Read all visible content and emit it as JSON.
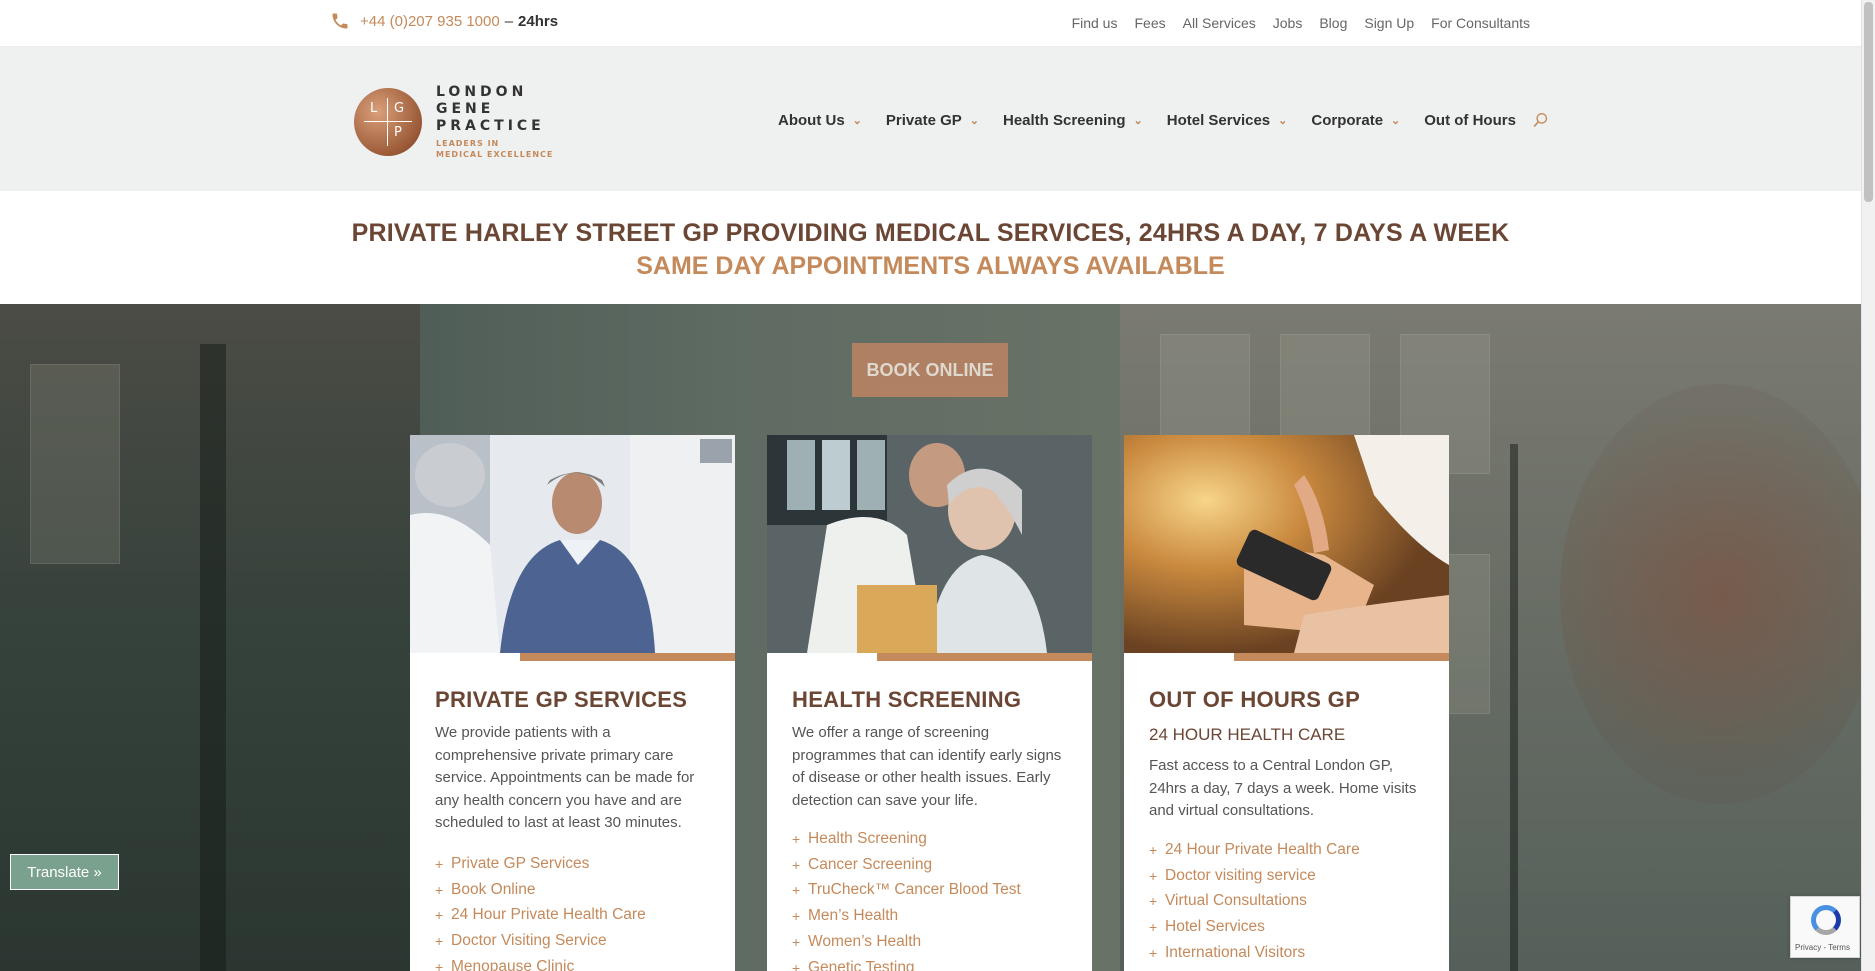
{
  "topbar": {
    "phone": "+44 (0)207 935 1000",
    "separator": "–",
    "hours": "24hrs",
    "links": [
      "Find us",
      "Fees",
      "All Services",
      "Jobs",
      "Blog",
      "Sign Up",
      "For Consultants"
    ]
  },
  "logo": {
    "letters": [
      "L",
      "G",
      "P"
    ],
    "name_lines": [
      "LONDON",
      "GENE",
      "PRACTICE"
    ],
    "tagline_lines": [
      "LEADERS IN",
      "MEDICAL EXCELLENCE"
    ]
  },
  "nav": {
    "items": [
      "About Us",
      "Private GP",
      "Health Screening",
      "Hotel Services",
      "Corporate",
      "Out of Hours"
    ]
  },
  "tagline": {
    "line1": "PRIVATE HARLEY STREET GP PROVIDING MEDICAL SERVICES, 24HRS A DAY, 7 DAYS A WEEK",
    "line2": "SAME DAY APPOINTMENTS ALWAYS AVAILABLE"
  },
  "hero": {
    "book_label": "BOOK ONLINE"
  },
  "cards": [
    {
      "title": "PRIVATE GP SERVICES",
      "subtitle": "",
      "description": "We provide patients with a comprehensive private primary care service. Appointments can be made for any health concern you have and are scheduled to last at least 30 minutes.",
      "links": [
        "Private GP Services",
        "Book Online",
        "24 Hour Private Health Care",
        "Doctor Visiting Service",
        "Menopause Clinic"
      ]
    },
    {
      "title": "HEALTH SCREENING",
      "subtitle": "",
      "description": "We offer a range of screening programmes that can identify early signs of disease or other health issues. Early detection can save your life.",
      "links": [
        "Health Screening",
        "Cancer Screening",
        "TruCheck™ Cancer Blood Test",
        "Men’s Health",
        "Women’s Health",
        "Genetic Testing"
      ]
    },
    {
      "title": "OUT OF HOURS GP",
      "subtitle": "24 HOUR HEALTH CARE",
      "description": "Fast access to a Central London GP, 24hrs a day, 7 days a week. Home visits and virtual consultations.",
      "links": [
        "24 Hour Private Health Care",
        "Doctor visiting service",
        "Virtual Consultations",
        "Hotel Services",
        "International Visitors"
      ]
    }
  ],
  "widgets": {
    "translate_label": "Translate »",
    "recaptcha_terms": "Privacy - Terms"
  },
  "colors": {
    "accent": "#c48a5b",
    "heading_brown": "#6b4634",
    "header_bg": "#eff0f0",
    "translate_bg": "#7aa18d"
  }
}
